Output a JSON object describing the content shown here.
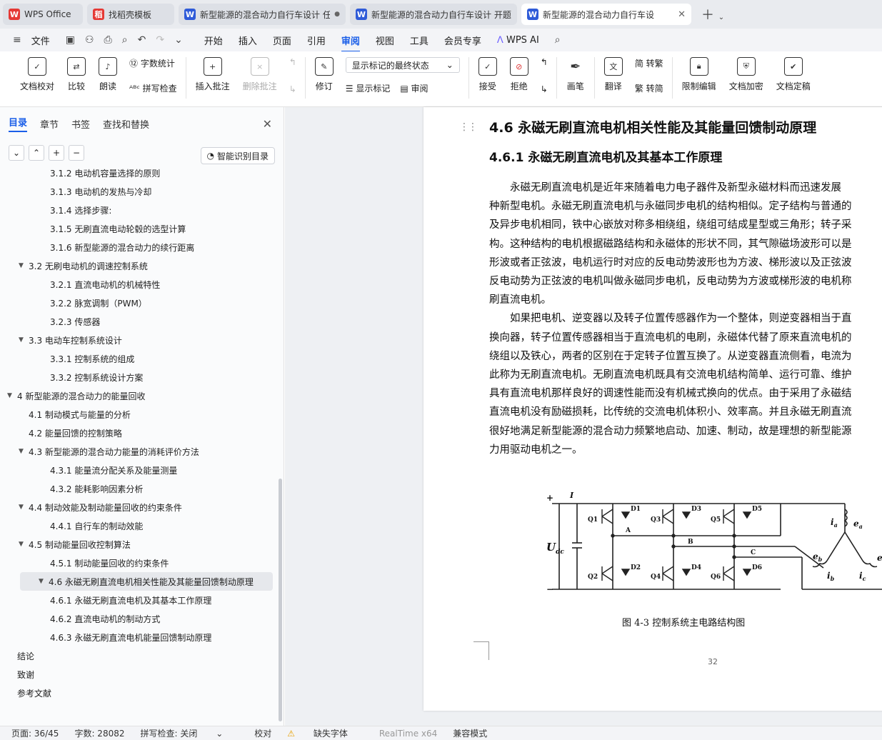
{
  "tabs": [
    {
      "label": "WPS Office",
      "icon": "W",
      "color": "#e53935"
    },
    {
      "label": "找稻壳模板",
      "icon": "稻",
      "color": "#e53935"
    },
    {
      "label": "新型能源的混合动力自行车设计 任",
      "icon": "W",
      "color": "#2f5bd8",
      "dot": "●"
    },
    {
      "label": "新型能源的混合动力自行车设计 开题",
      "icon": "W",
      "color": "#2f5bd8"
    },
    {
      "label": "新型能源的混合动力自行车设",
      "icon": "W",
      "color": "#2f5bd8",
      "close": "✕"
    }
  ],
  "menu": {
    "file": "文件",
    "items": [
      "开始",
      "插入",
      "页面",
      "引用",
      "审阅",
      "视图",
      "工具",
      "会员专享"
    ],
    "active": "审阅",
    "ai": "WPS AI"
  },
  "ribbon": {
    "proof": "文档校对",
    "compare": "比较",
    "read": "朗读",
    "wordcount": "字数统计",
    "spell": "拼写检查",
    "insert_comment": "插入批注",
    "delete_comment": "删除批注",
    "revise": "修订",
    "markup_state": "显示标记的最终状态",
    "show_markup": "显示标记",
    "review": "审阅",
    "accept": "接受",
    "reject": "拒绝",
    "pen": "画笔",
    "translate": "翻译",
    "to_trad": "转繁",
    "to_simp": "转简",
    "restrict": "限制编辑",
    "encrypt": "文档加密",
    "finalize": "文档定稿"
  },
  "sidebar": {
    "tabs": [
      "目录",
      "章节",
      "书签",
      "查找和替换"
    ],
    "smart": "智能识别目录",
    "toc": [
      {
        "label": "3.1.2  电动机容量选择的原则",
        "level": 3
      },
      {
        "label": "3.1.3  电动机的发热与冷却",
        "level": 3
      },
      {
        "label": "3.1.4  选择步骤:",
        "level": 3
      },
      {
        "label": "3.1.5  无刷直流电动轮毂的选型计算",
        "level": 3
      },
      {
        "label": "3.1.6  新型能源的混合动力的续行距离",
        "level": 3
      },
      {
        "label": "3.2  无刷电动机的调速控制系统",
        "level": 2,
        "arrow": "▼"
      },
      {
        "label": "3.2.1  直流电动机的机械特性",
        "level": 3
      },
      {
        "label": "3.2.2  脉宽调制（PWM）",
        "level": 3
      },
      {
        "label": "3.2.3  传感器",
        "level": 3
      },
      {
        "label": "3.3  电动车控制系统设计",
        "level": 2,
        "arrow": "▼"
      },
      {
        "label": "3.3.1  控制系统的组成",
        "level": 3
      },
      {
        "label": "3.3.2  控制系统设计方案",
        "level": 3
      },
      {
        "label": "4  新型能源的混合动力的能量回收",
        "level": 1,
        "arrow": "▼"
      },
      {
        "label": "4.1  制动模式与能量的分析",
        "level": 2
      },
      {
        "label": "4.2  能量回馈的控制策略",
        "level": 2
      },
      {
        "label": "4.3  新型能源的混合动力能量的消耗评价方法",
        "level": 2,
        "arrow": "▼"
      },
      {
        "label": "4.3.1  能量流分配关系及能量测量",
        "level": 3
      },
      {
        "label": "4.3.2  能耗影响因素分析",
        "level": 3
      },
      {
        "label": "4.4  制动效能及制动能量回收的约束条件",
        "level": 2,
        "arrow": "▼"
      },
      {
        "label": "4.4.1  自行车的制动效能",
        "level": 3
      },
      {
        "label": "4.5  制动能量回收控制算法",
        "level": 2,
        "arrow": "▼"
      },
      {
        "label": "4.5.1  制动能量回收的约束条件",
        "level": 3
      },
      {
        "label": "4.6  永磁无刷直流电机相关性能及其能量回馈制动原理",
        "level": 2,
        "arrow": "▼",
        "selected": true
      },
      {
        "label": "4.6.1  永磁无刷直流电机及其基本工作原理",
        "level": 3
      },
      {
        "label": "4.6.2  直流电动机的制动方式",
        "level": 3
      },
      {
        "label": "4.6.3  永磁无刷直流电机能量回馈制动原理",
        "level": 3
      },
      {
        "label": "结论",
        "level": 1
      },
      {
        "label": "致谢",
        "level": 1
      },
      {
        "label": "参考文献",
        "level": 1
      }
    ]
  },
  "doc": {
    "h1": "4.6  永磁无刷直流电机相关性能及其能量回馈制动原理",
    "h2": "4.6.1  永磁无刷直流电机及其基本工作原理",
    "lines": [
      "　　永磁无刷直流电机是近年来随着电力电子器件及新型永磁材料而迅速发展",
      "种新型电机。永磁无刷直流电机与永磁同步电机的结构相似。定子结构与普通的",
      "及异步电机相同，铁中心嵌放对称多相绕组，绕组可结成星型或三角形；转子采",
      "构。这种结构的电机根据磁路结构和永磁体的形状不同，其气隙磁场波形可以是",
      "形波或者正弦波，电机运行时对应的反电动势波形也为方波、梯形波以及正弦波",
      "反电动势为正弦波的电机叫做永磁同步电机，反电动势为方波或梯形波的电机称",
      "刷直流电机。",
      "　　如果把电机、逆变器以及转子位置传感器作为一个整体，则逆变器相当于直",
      "换向器，转子位置传感器相当于直流电机的电刷，永磁体代替了原来直流电机的",
      "绕组以及铁心，两者的区别在于定转子位置互换了。从逆变器直流侧看，电流为",
      "此称为无刷直流电机。无刷直流电机既具有交流电机结构简单、运行可靠、维护",
      "具有直流电机那样良好的调速性能而没有机械式换向的优点。由于采用了永磁结",
      "直流电机没有励磁损耗，比传统的交流电机体积小、效率高。并且永磁无刷直流",
      "很好地满足新型能源的混合动力频繁地启动、加速、制动，故是理想的新型能源",
      "力用驱动电机之一。"
    ],
    "caption": "图 4-3 控制系统主电路结构图",
    "page_number": "32",
    "circuit": {
      "q": [
        "Q1",
        "Q3",
        "Q5",
        "Q4",
        "Q6",
        "Q2"
      ],
      "d": [
        "D1",
        "D3",
        "D5",
        "D2",
        "D4",
        "D6"
      ],
      "nodes": [
        "A",
        "B",
        "C"
      ],
      "udc": "U",
      "udc_sub": "dc",
      "i": "I",
      "ia": "i",
      "ia_sub": "a",
      "ea": "e",
      "ea_sub": "a",
      "eb": "e",
      "eb_sub": "b",
      "ib": "i",
      "ib_sub": "b",
      "ic": "i",
      "ic_sub": "c",
      "ec": "e",
      "plus": "+",
      "minus": "−"
    }
  },
  "status": {
    "page": "页面: 36/45",
    "words": "字数: 28082",
    "spell": "拼写检查: 关闭",
    "proof": "校对",
    "font": "缺失字体",
    "overlay": "RealTime x64",
    "compat": "兼容模式"
  }
}
